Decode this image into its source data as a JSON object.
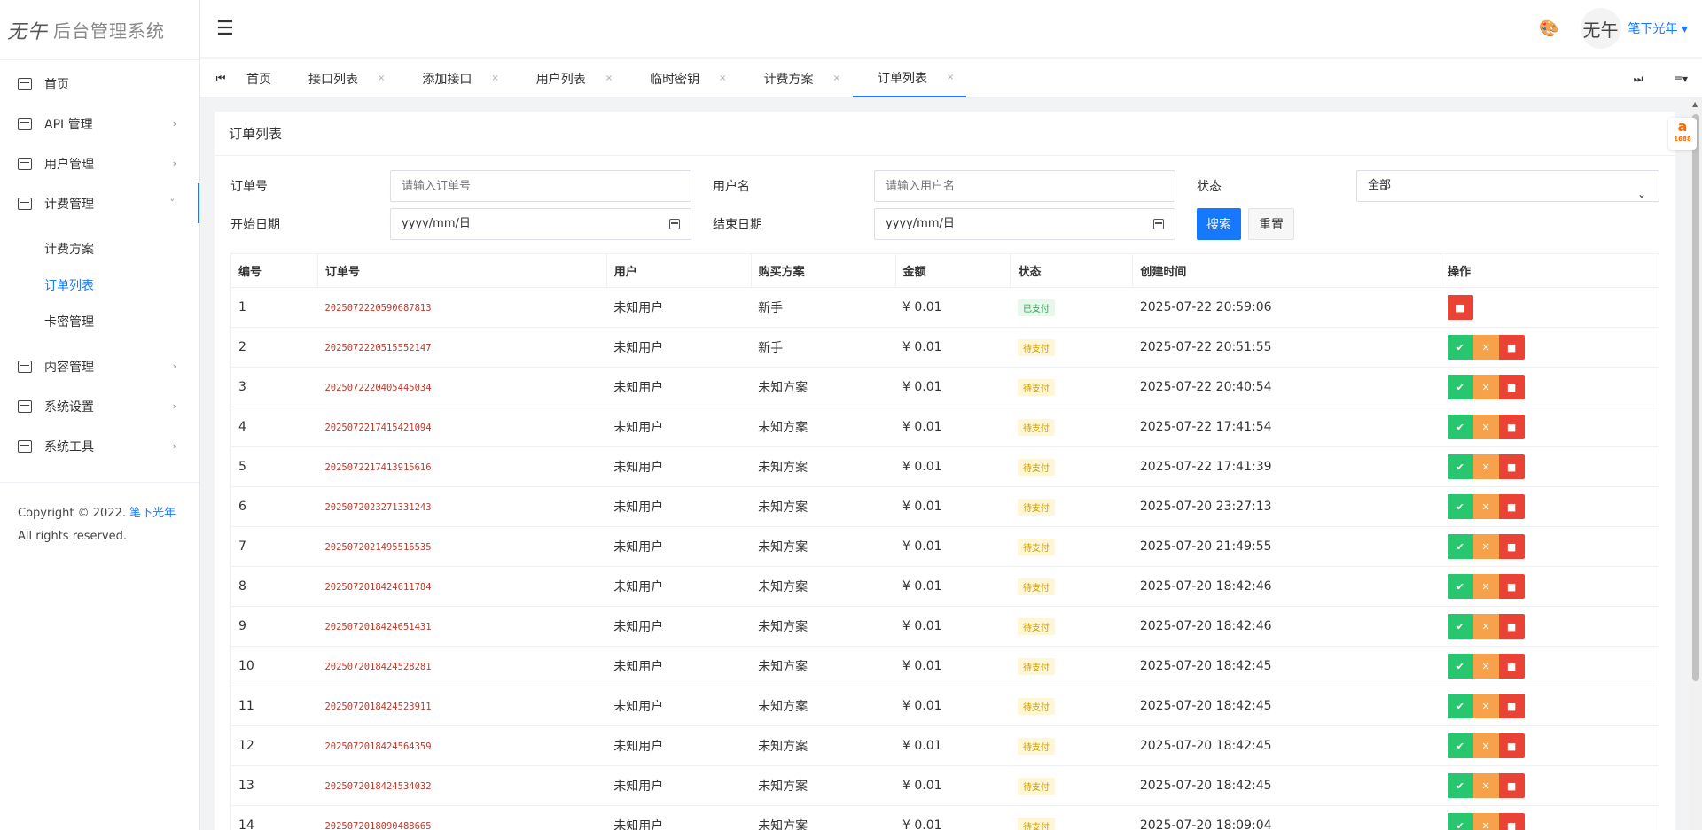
{
  "app": {
    "logo_mark": "无午",
    "title": "后台管理系统"
  },
  "sidebar": {
    "items": [
      {
        "label": "首页",
        "chevron": ""
      },
      {
        "label": "API 管理",
        "chevron": "›"
      },
      {
        "label": "用户管理",
        "chevron": "›"
      },
      {
        "label": "计费管理",
        "chevron": "˅"
      },
      {
        "label": "内容管理",
        "chevron": "›"
      },
      {
        "label": "系统设置",
        "chevron": "›"
      },
      {
        "label": "系统工具",
        "chevron": "›"
      }
    ],
    "submenu": [
      "计费方案",
      "订单列表",
      "卡密管理"
    ],
    "copyright_prefix": "Copyright © 2022. ",
    "copyright_link": "笔下光年",
    "copyright_suffix": " All rights reserved."
  },
  "header": {
    "user": "笔下光年 ▾",
    "avatar_text": "无午"
  },
  "tabs": {
    "home": "首页",
    "items": [
      "接口列表",
      "添加接口",
      "用户列表",
      "临时密钥",
      "计费方案",
      "订单列表"
    ],
    "close": "×",
    "prev_icon": "⏮",
    "next_icon": "⏭",
    "menu_icon": "≡▾"
  },
  "card": {
    "title": "订单列表"
  },
  "filters": {
    "order_label": "订单号",
    "order_placeholder": "请输入订单号",
    "user_label": "用户名",
    "user_placeholder": "请输入用户名",
    "status_label": "状态",
    "status_value": "全部",
    "start_label": "开始日期",
    "start_value": "yyyy/mm/日",
    "end_label": "结束日期",
    "end_value": "yyyy/mm/日",
    "search_btn": "搜索",
    "reset_btn": "重置"
  },
  "table": {
    "headers": [
      "编号",
      "订单号",
      "用户",
      "购买方案",
      "金额",
      "状态",
      "创建时间",
      "操作"
    ],
    "rows": [
      {
        "id": "1",
        "order": "2025072220590687813",
        "user": "未知用户",
        "plan": "新手",
        "amount": "¥ 0.01",
        "status": "已支付",
        "time": "2025-07-22 20:59:06"
      },
      {
        "id": "2",
        "order": "2025072220515552147",
        "user": "未知用户",
        "plan": "新手",
        "amount": "¥ 0.01",
        "status": "待支付",
        "time": "2025-07-22 20:51:55"
      },
      {
        "id": "3",
        "order": "2025072220405445034",
        "user": "未知用户",
        "plan": "未知方案",
        "amount": "¥ 0.01",
        "status": "待支付",
        "time": "2025-07-22 20:40:54"
      },
      {
        "id": "4",
        "order": "2025072217415421094",
        "user": "未知用户",
        "plan": "未知方案",
        "amount": "¥ 0.01",
        "status": "待支付",
        "time": "2025-07-22 17:41:54"
      },
      {
        "id": "5",
        "order": "2025072217413915616",
        "user": "未知用户",
        "plan": "未知方案",
        "amount": "¥ 0.01",
        "status": "待支付",
        "time": "2025-07-22 17:41:39"
      },
      {
        "id": "6",
        "order": "2025072023271331243",
        "user": "未知用户",
        "plan": "未知方案",
        "amount": "¥ 0.01",
        "status": "待支付",
        "time": "2025-07-20 23:27:13"
      },
      {
        "id": "7",
        "order": "2025072021495516535",
        "user": "未知用户",
        "plan": "未知方案",
        "amount": "¥ 0.01",
        "status": "待支付",
        "time": "2025-07-20 21:49:55"
      },
      {
        "id": "8",
        "order": "2025072018424611784",
        "user": "未知用户",
        "plan": "未知方案",
        "amount": "¥ 0.01",
        "status": "待支付",
        "time": "2025-07-20 18:42:46"
      },
      {
        "id": "9",
        "order": "2025072018424651431",
        "user": "未知用户",
        "plan": "未知方案",
        "amount": "¥ 0.01",
        "status": "待支付",
        "time": "2025-07-20 18:42:46"
      },
      {
        "id": "10",
        "order": "2025072018424528281",
        "user": "未知用户",
        "plan": "未知方案",
        "amount": "¥ 0.01",
        "status": "待支付",
        "time": "2025-07-20 18:42:45"
      },
      {
        "id": "11",
        "order": "2025072018424523911",
        "user": "未知用户",
        "plan": "未知方案",
        "amount": "¥ 0.01",
        "status": "待支付",
        "time": "2025-07-20 18:42:45"
      },
      {
        "id": "12",
        "order": "2025072018424564359",
        "user": "未知用户",
        "plan": "未知方案",
        "amount": "¥ 0.01",
        "status": "待支付",
        "time": "2025-07-20 18:42:45"
      },
      {
        "id": "13",
        "order": "2025072018424534032",
        "user": "未知用户",
        "plan": "未知方案",
        "amount": "¥ 0.01",
        "status": "待支付",
        "time": "2025-07-20 18:42:45"
      },
      {
        "id": "14",
        "order": "2025072018090488665",
        "user": "未知用户",
        "plan": "未知方案",
        "amount": "¥ 0.01",
        "status": "待支付",
        "time": "2025-07-20 18:09:04"
      }
    ],
    "ok_icon": "✔",
    "cancel_icon": "✕",
    "delete_icon": "■"
  },
  "floating": {
    "text": "a",
    "sub": "1688"
  },
  "colors": {
    "accent": "#1677ff",
    "success": "#28c76f",
    "warning": "#f7a14a",
    "danger": "#ea4335"
  }
}
